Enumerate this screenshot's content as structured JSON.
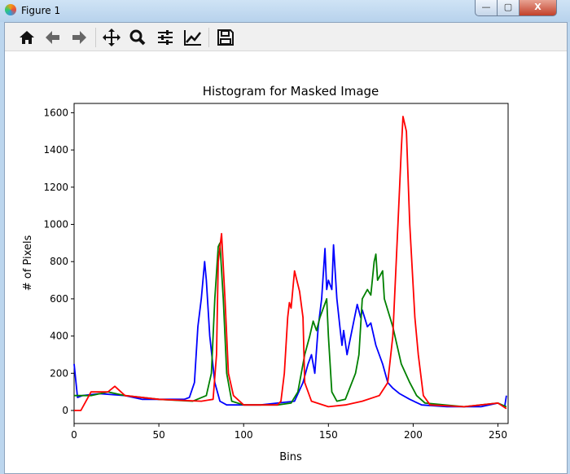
{
  "window": {
    "title": "Figure 1",
    "minimize": "—",
    "maximize": "▢",
    "close": "X"
  },
  "toolbar": [
    "home-icon",
    "back-icon",
    "forward-icon",
    "pan-icon",
    "zoom-icon",
    "configure-subplots-icon",
    "edit-axis-icon",
    "save-icon"
  ],
  "colors": {
    "blue": "#0000ff",
    "green": "#008000",
    "red": "#ff0000"
  },
  "chart_data": {
    "type": "line",
    "title": "Histogram for Masked Image",
    "xlabel": "Bins",
    "ylabel": "# of Pixels",
    "xlim": [
      0,
      256
    ],
    "ylim": [
      -70,
      1650
    ],
    "xticks": [
      0,
      50,
      100,
      150,
      200,
      250
    ],
    "yticks": [
      0,
      200,
      400,
      600,
      800,
      1000,
      1200,
      1400,
      1600
    ],
    "series": [
      {
        "name": "b",
        "color": "#0000ff",
        "points": [
          [
            0,
            250
          ],
          [
            2,
            70
          ],
          [
            5,
            80
          ],
          [
            15,
            90
          ],
          [
            30,
            80
          ],
          [
            40,
            60
          ],
          [
            65,
            60
          ],
          [
            68,
            70
          ],
          [
            71,
            150
          ],
          [
            73,
            450
          ],
          [
            75,
            600
          ],
          [
            77,
            800
          ],
          [
            78,
            700
          ],
          [
            80,
            400
          ],
          [
            83,
            150
          ],
          [
            86,
            50
          ],
          [
            90,
            30
          ],
          [
            110,
            30
          ],
          [
            120,
            40
          ],
          [
            130,
            50
          ],
          [
            135,
            150
          ],
          [
            138,
            250
          ],
          [
            140,
            300
          ],
          [
            142,
            200
          ],
          [
            144,
            450
          ],
          [
            146,
            600
          ],
          [
            148,
            870
          ],
          [
            149,
            650
          ],
          [
            150,
            700
          ],
          [
            152,
            650
          ],
          [
            153,
            890
          ],
          [
            155,
            600
          ],
          [
            157,
            430
          ],
          [
            158,
            350
          ],
          [
            159,
            430
          ],
          [
            161,
            300
          ],
          [
            165,
            480
          ],
          [
            167,
            570
          ],
          [
            169,
            500
          ],
          [
            170,
            540
          ],
          [
            173,
            450
          ],
          [
            175,
            470
          ],
          [
            178,
            350
          ],
          [
            182,
            250
          ],
          [
            185,
            150
          ],
          [
            188,
            120
          ],
          [
            192,
            90
          ],
          [
            198,
            60
          ],
          [
            205,
            30
          ],
          [
            220,
            20
          ],
          [
            240,
            20
          ],
          [
            250,
            40
          ],
          [
            254,
            20
          ],
          [
            255,
            80
          ]
        ]
      },
      {
        "name": "g",
        "color": "#008000",
        "points": [
          [
            0,
            80
          ],
          [
            10,
            80
          ],
          [
            20,
            100
          ],
          [
            30,
            80
          ],
          [
            50,
            60
          ],
          [
            70,
            50
          ],
          [
            78,
            80
          ],
          [
            81,
            200
          ],
          [
            83,
            600
          ],
          [
            85,
            880
          ],
          [
            86,
            900
          ],
          [
            88,
            600
          ],
          [
            90,
            200
          ],
          [
            93,
            50
          ],
          [
            100,
            30
          ],
          [
            120,
            30
          ],
          [
            128,
            40
          ],
          [
            132,
            100
          ],
          [
            136,
            300
          ],
          [
            139,
            400
          ],
          [
            141,
            480
          ],
          [
            143,
            430
          ],
          [
            145,
            500
          ],
          [
            149,
            600
          ],
          [
            150,
            400
          ],
          [
            152,
            100
          ],
          [
            155,
            50
          ],
          [
            160,
            60
          ],
          [
            166,
            200
          ],
          [
            168,
            300
          ],
          [
            170,
            600
          ],
          [
            173,
            650
          ],
          [
            175,
            620
          ],
          [
            177,
            800
          ],
          [
            178,
            840
          ],
          [
            179,
            700
          ],
          [
            182,
            750
          ],
          [
            183,
            600
          ],
          [
            188,
            450
          ],
          [
            193,
            250
          ],
          [
            198,
            150
          ],
          [
            202,
            80
          ],
          [
            207,
            40
          ],
          [
            230,
            20
          ],
          [
            250,
            40
          ],
          [
            255,
            20
          ]
        ]
      },
      {
        "name": "r",
        "color": "#ff0000",
        "points": [
          [
            0,
            0
          ],
          [
            4,
            0
          ],
          [
            7,
            50
          ],
          [
            10,
            100
          ],
          [
            20,
            100
          ],
          [
            24,
            130
          ],
          [
            30,
            80
          ],
          [
            50,
            60
          ],
          [
            75,
            50
          ],
          [
            82,
            60
          ],
          [
            84,
            300
          ],
          [
            85,
            800
          ],
          [
            87,
            950
          ],
          [
            89,
            600
          ],
          [
            91,
            200
          ],
          [
            94,
            80
          ],
          [
            100,
            30
          ],
          [
            120,
            30
          ],
          [
            122,
            50
          ],
          [
            124,
            200
          ],
          [
            126,
            500
          ],
          [
            127,
            580
          ],
          [
            128,
            550
          ],
          [
            130,
            750
          ],
          [
            133,
            640
          ],
          [
            135,
            500
          ],
          [
            136,
            150
          ],
          [
            140,
            50
          ],
          [
            150,
            20
          ],
          [
            160,
            30
          ],
          [
            170,
            50
          ],
          [
            180,
            80
          ],
          [
            185,
            150
          ],
          [
            188,
            400
          ],
          [
            191,
            1000
          ],
          [
            193,
            1400
          ],
          [
            194,
            1580
          ],
          [
            196,
            1500
          ],
          [
            198,
            1000
          ],
          [
            201,
            500
          ],
          [
            203,
            300
          ],
          [
            206,
            80
          ],
          [
            210,
            30
          ],
          [
            230,
            20
          ],
          [
            250,
            40
          ],
          [
            255,
            10
          ]
        ]
      }
    ]
  }
}
